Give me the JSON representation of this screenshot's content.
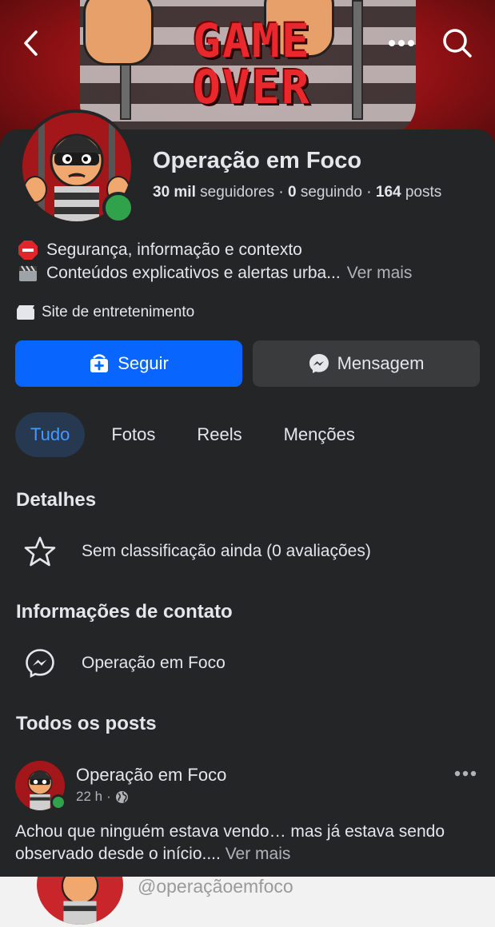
{
  "cover": {
    "artwork_text": [
      "GAME",
      "OVER"
    ]
  },
  "topbar": {
    "back_icon": "chevron-left-icon",
    "more_icon": "ellipsis-icon",
    "search_icon": "search-icon"
  },
  "profile": {
    "name": "Operação em Foco",
    "followers_count": "30 mil",
    "followers_label": "seguidores",
    "following_count": "0",
    "following_label": "seguindo",
    "posts_count": "164",
    "posts_label": "posts",
    "separator": "·"
  },
  "bio": {
    "line1": "Segurança, informação e contexto",
    "line2": "Conteúdos explicativos e alertas urba...",
    "see_more": "Ver mais"
  },
  "category": "Site de entretenimento",
  "actions": {
    "follow_label": "Seguir",
    "message_label": "Mensagem"
  },
  "tabs": [
    {
      "label": "Tudo",
      "active": true
    },
    {
      "label": "Fotos",
      "active": false
    },
    {
      "label": "Reels",
      "active": false
    },
    {
      "label": "Menções",
      "active": false
    }
  ],
  "details": {
    "title": "Detalhes",
    "rating_text": "Sem classificação ainda (0 avaliações)"
  },
  "contact": {
    "title": "Informações de contato",
    "messenger_name": "Operação em Foco"
  },
  "posts_section": {
    "title": "Todos os posts",
    "post": {
      "author": "Operação em Foco",
      "time": "22 h",
      "dot": "·",
      "text": "Achou que ninguém estava vendo… mas já estava sendo observado desde o início....",
      "see_more": "Ver mais"
    }
  },
  "overlay": {
    "handle": "@operaçãoemfoco"
  },
  "colors": {
    "accent": "#0866ff",
    "background": "#242526",
    "online": "#31a24c",
    "cover_red": "#c8262a"
  }
}
